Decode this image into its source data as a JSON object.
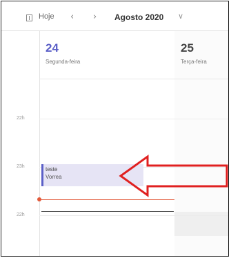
{
  "toolbar": {
    "today_label": "Hoje",
    "prev_icon": "chevron-left-icon",
    "next_icon": "chevron-right-icon",
    "month_label": "Agosto 2020",
    "month_chevron_icon": "chevron-down-icon"
  },
  "days": [
    {
      "number": "24",
      "name": "Segunda-feira",
      "is_today": true
    },
    {
      "number": "25",
      "name": "Terça-feira",
      "is_today": false
    }
  ],
  "hours": [
    "22h",
    "23h",
    "22h"
  ],
  "event": {
    "title": "teste",
    "location": "Vorrea"
  },
  "colors": {
    "accent": "#5b5fc7",
    "event_bg": "#e6e4f5",
    "now_line": "#e35a3a",
    "annotation_arrow": "#e02020"
  },
  "annotation": {
    "shape": "red-outline-arrow-pointing-left"
  }
}
